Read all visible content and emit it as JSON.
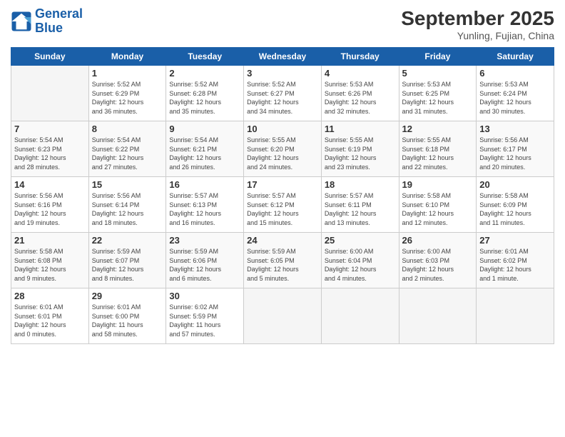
{
  "logo": {
    "line1": "General",
    "line2": "Blue"
  },
  "title": "September 2025",
  "location": "Yunling, Fujian, China",
  "headers": [
    "Sunday",
    "Monday",
    "Tuesday",
    "Wednesday",
    "Thursday",
    "Friday",
    "Saturday"
  ],
  "weeks": [
    [
      {
        "day": "",
        "info": ""
      },
      {
        "day": "1",
        "info": "Sunrise: 5:52 AM\nSunset: 6:29 PM\nDaylight: 12 hours\nand 36 minutes."
      },
      {
        "day": "2",
        "info": "Sunrise: 5:52 AM\nSunset: 6:28 PM\nDaylight: 12 hours\nand 35 minutes."
      },
      {
        "day": "3",
        "info": "Sunrise: 5:52 AM\nSunset: 6:27 PM\nDaylight: 12 hours\nand 34 minutes."
      },
      {
        "day": "4",
        "info": "Sunrise: 5:53 AM\nSunset: 6:26 PM\nDaylight: 12 hours\nand 32 minutes."
      },
      {
        "day": "5",
        "info": "Sunrise: 5:53 AM\nSunset: 6:25 PM\nDaylight: 12 hours\nand 31 minutes."
      },
      {
        "day": "6",
        "info": "Sunrise: 5:53 AM\nSunset: 6:24 PM\nDaylight: 12 hours\nand 30 minutes."
      }
    ],
    [
      {
        "day": "7",
        "info": "Sunrise: 5:54 AM\nSunset: 6:23 PM\nDaylight: 12 hours\nand 28 minutes."
      },
      {
        "day": "8",
        "info": "Sunrise: 5:54 AM\nSunset: 6:22 PM\nDaylight: 12 hours\nand 27 minutes."
      },
      {
        "day": "9",
        "info": "Sunrise: 5:54 AM\nSunset: 6:21 PM\nDaylight: 12 hours\nand 26 minutes."
      },
      {
        "day": "10",
        "info": "Sunrise: 5:55 AM\nSunset: 6:20 PM\nDaylight: 12 hours\nand 24 minutes."
      },
      {
        "day": "11",
        "info": "Sunrise: 5:55 AM\nSunset: 6:19 PM\nDaylight: 12 hours\nand 23 minutes."
      },
      {
        "day": "12",
        "info": "Sunrise: 5:55 AM\nSunset: 6:18 PM\nDaylight: 12 hours\nand 22 minutes."
      },
      {
        "day": "13",
        "info": "Sunrise: 5:56 AM\nSunset: 6:17 PM\nDaylight: 12 hours\nand 20 minutes."
      }
    ],
    [
      {
        "day": "14",
        "info": "Sunrise: 5:56 AM\nSunset: 6:16 PM\nDaylight: 12 hours\nand 19 minutes."
      },
      {
        "day": "15",
        "info": "Sunrise: 5:56 AM\nSunset: 6:14 PM\nDaylight: 12 hours\nand 18 minutes."
      },
      {
        "day": "16",
        "info": "Sunrise: 5:57 AM\nSunset: 6:13 PM\nDaylight: 12 hours\nand 16 minutes."
      },
      {
        "day": "17",
        "info": "Sunrise: 5:57 AM\nSunset: 6:12 PM\nDaylight: 12 hours\nand 15 minutes."
      },
      {
        "day": "18",
        "info": "Sunrise: 5:57 AM\nSunset: 6:11 PM\nDaylight: 12 hours\nand 13 minutes."
      },
      {
        "day": "19",
        "info": "Sunrise: 5:58 AM\nSunset: 6:10 PM\nDaylight: 12 hours\nand 12 minutes."
      },
      {
        "day": "20",
        "info": "Sunrise: 5:58 AM\nSunset: 6:09 PM\nDaylight: 12 hours\nand 11 minutes."
      }
    ],
    [
      {
        "day": "21",
        "info": "Sunrise: 5:58 AM\nSunset: 6:08 PM\nDaylight: 12 hours\nand 9 minutes."
      },
      {
        "day": "22",
        "info": "Sunrise: 5:59 AM\nSunset: 6:07 PM\nDaylight: 12 hours\nand 8 minutes."
      },
      {
        "day": "23",
        "info": "Sunrise: 5:59 AM\nSunset: 6:06 PM\nDaylight: 12 hours\nand 6 minutes."
      },
      {
        "day": "24",
        "info": "Sunrise: 5:59 AM\nSunset: 6:05 PM\nDaylight: 12 hours\nand 5 minutes."
      },
      {
        "day": "25",
        "info": "Sunrise: 6:00 AM\nSunset: 6:04 PM\nDaylight: 12 hours\nand 4 minutes."
      },
      {
        "day": "26",
        "info": "Sunrise: 6:00 AM\nSunset: 6:03 PM\nDaylight: 12 hours\nand 2 minutes."
      },
      {
        "day": "27",
        "info": "Sunrise: 6:01 AM\nSunset: 6:02 PM\nDaylight: 12 hours\nand 1 minute."
      }
    ],
    [
      {
        "day": "28",
        "info": "Sunrise: 6:01 AM\nSunset: 6:01 PM\nDaylight: 12 hours\nand 0 minutes."
      },
      {
        "day": "29",
        "info": "Sunrise: 6:01 AM\nSunset: 6:00 PM\nDaylight: 11 hours\nand 58 minutes."
      },
      {
        "day": "30",
        "info": "Sunrise: 6:02 AM\nSunset: 5:59 PM\nDaylight: 11 hours\nand 57 minutes."
      },
      {
        "day": "",
        "info": ""
      },
      {
        "day": "",
        "info": ""
      },
      {
        "day": "",
        "info": ""
      },
      {
        "day": "",
        "info": ""
      }
    ]
  ]
}
